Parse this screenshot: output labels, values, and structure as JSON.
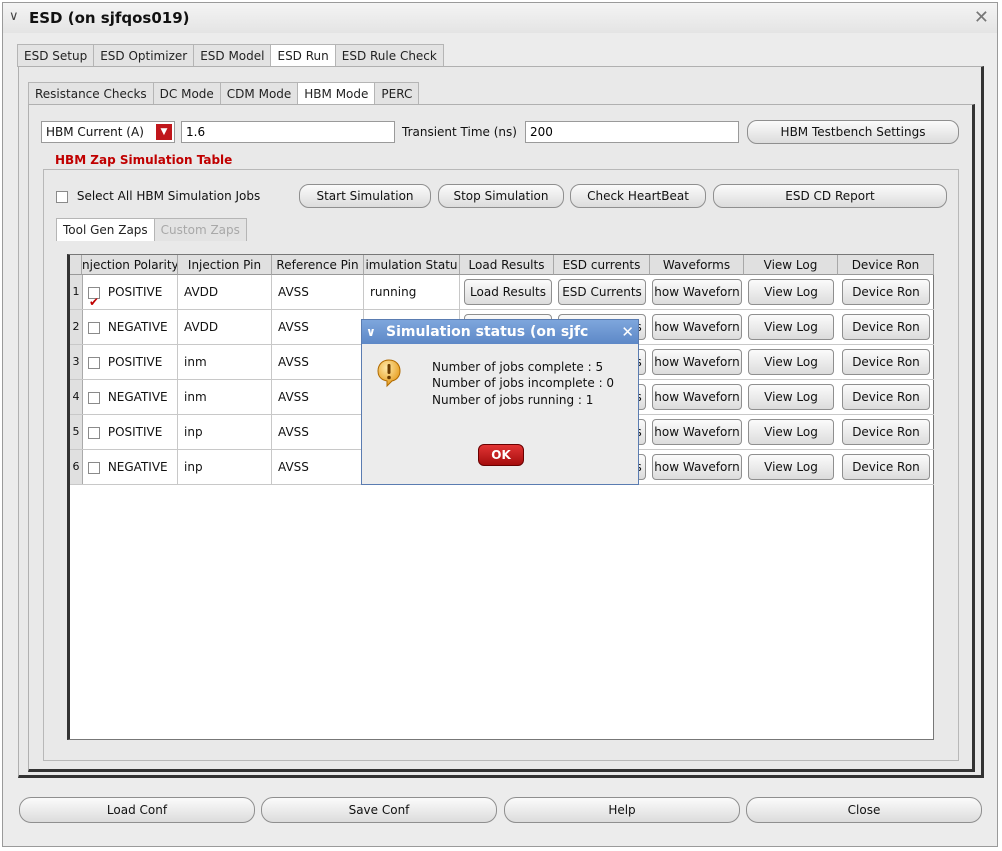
{
  "window": {
    "title": "ESD (on sjfqos019)"
  },
  "main_tabs": [
    "ESD Setup",
    "ESD Optimizer",
    "ESD Model",
    "ESD Run",
    "ESD Rule Check"
  ],
  "run_tabs": [
    "Resistance Checks",
    "DC Mode",
    "CDM Mode",
    "HBM Mode",
    "PERC"
  ],
  "hbm": {
    "current_select": "HBM Current (A)",
    "current_value": "1.6",
    "transient_label": "Transient Time (ns)",
    "transient_value": "200",
    "testbench_button": "HBM Testbench Settings"
  },
  "zap_table": {
    "legend": "HBM Zap Simulation Table",
    "select_all_label": "Select All HBM Simulation Jobs",
    "buttons": {
      "start": "Start Simulation",
      "stop": "Stop Simulation",
      "heartbeat": "Check HeartBeat",
      "report": "ESD CD Report"
    },
    "subtabs": [
      "Tool Gen Zaps",
      "Custom Zaps"
    ],
    "columns": [
      "njection Polarity",
      "Injection Pin",
      "Reference Pin",
      "imulation Statu",
      "Load Results",
      "ESD currents",
      "Waveforms",
      "View Log",
      "Device Ron"
    ],
    "rows": [
      {
        "num": "1",
        "checked": true,
        "polarity": "POSITIVE",
        "injection": "AVDD",
        "reference": "AVSS",
        "status": "running"
      },
      {
        "num": "2",
        "checked": false,
        "polarity": "NEGATIVE",
        "injection": "AVDD",
        "reference": "AVSS",
        "status": ""
      },
      {
        "num": "3",
        "checked": false,
        "polarity": "POSITIVE",
        "injection": "inm",
        "reference": "AVSS",
        "status": ""
      },
      {
        "num": "4",
        "checked": false,
        "polarity": "NEGATIVE",
        "injection": "inm",
        "reference": "AVSS",
        "status": ""
      },
      {
        "num": "5",
        "checked": false,
        "polarity": "POSITIVE",
        "injection": "inp",
        "reference": "AVSS",
        "status": ""
      },
      {
        "num": "6",
        "checked": false,
        "polarity": "NEGATIVE",
        "injection": "inp",
        "reference": "AVSS",
        "status": ""
      }
    ],
    "cell_buttons": {
      "load": "Load Results",
      "esd": "ESD Currents",
      "waveform": "how Waveforn",
      "log": "View Log",
      "ron": "Device Ron"
    }
  },
  "dialog": {
    "title": "Simulation status (on sjfc",
    "lines": [
      "Number of jobs complete    : 5",
      "Number of jobs incomplete   : 0",
      "Number of jobs running : 1"
    ],
    "ok": "OK"
  },
  "footer": {
    "load_conf": "Load Conf",
    "save_conf": "Save Conf",
    "help": "Help",
    "close": "Close"
  },
  "colors": {
    "accent_red": "#c00000",
    "dialog_title": "#5d88c7"
  }
}
